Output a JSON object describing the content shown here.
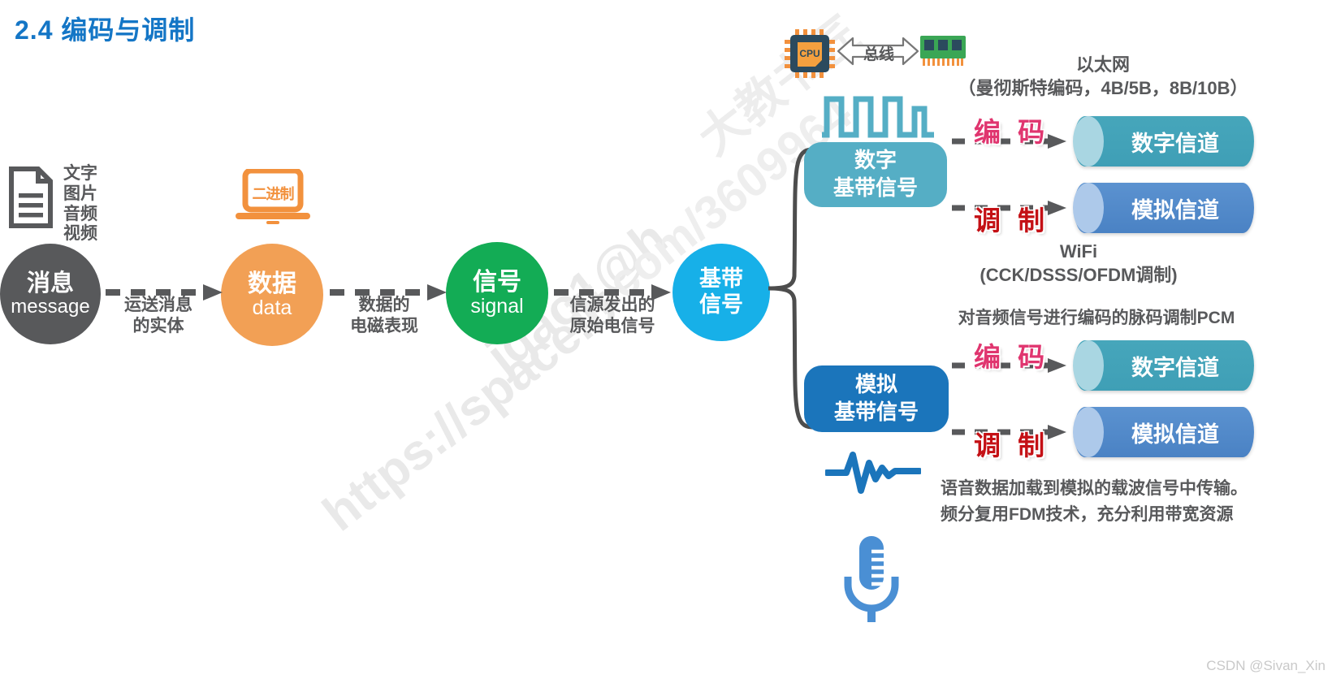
{
  "title": "2.4 编码与调制",
  "accent_color": "#1476c6",
  "flow": {
    "doc_label": "文字\n图片\n音频\n视频",
    "doc_lines": [
      "文字",
      "图片",
      "音频",
      "视频"
    ],
    "laptop_text": "二进制",
    "nodes": [
      {
        "cn": "消息",
        "en": "message",
        "color": "#58595b"
      },
      {
        "cn": "数据",
        "en": "data",
        "color": "#f2a055"
      },
      {
        "cn": "信号",
        "en": "signal",
        "color": "#13ac55"
      },
      {
        "cn": "基带",
        "en": "信号",
        "color": "#17b0e8"
      }
    ],
    "arrow_labels": [
      "运送消息\n的实体",
      "数据的\n电磁表现",
      "信源发出的\n原始电信号"
    ],
    "arrow_label_1a": "运送消息",
    "arrow_label_1b": "的实体",
    "arrow_label_2a": "数据的",
    "arrow_label_2b": "电磁表现",
    "arrow_label_3a": "信源发出的",
    "arrow_label_3b": "原始电信号"
  },
  "hardware": {
    "cpu_label": "CPU",
    "bus_label": "总线"
  },
  "right": {
    "digital_bb_line1": "数字",
    "digital_bb_line2": "基带信号",
    "analog_bb_line1": "模拟",
    "analog_bb_line2": "基带信号",
    "encode_label": "编 码",
    "modulate_label": "调 制",
    "ethernet_line1": "以太网",
    "ethernet_line2": "（曼彻斯特编码，4B/5B，8B/10B）",
    "wifi_line1": "WiFi",
    "wifi_line2": "(CCK/DSSS/OFDM调制)",
    "pcm_text": "对音频信号进行编码的脉码调制PCM",
    "fdm_line1": "语音数据加载到模拟的载波信号中传输。",
    "fdm_line2": "频分复用FDM技术，充分利用带宽资源",
    "channels": [
      {
        "label": "数字信道",
        "color": "#46a6bb"
      },
      {
        "label": "模拟信道",
        "color": "#5b92d0"
      },
      {
        "label": "数字信道",
        "color": "#46a6bb"
      },
      {
        "label": "模拟信道",
        "color": "#5b92d0"
      }
    ],
    "channel_digital": "数字信道",
    "channel_analog": "模拟信道"
  },
  "watermark": {
    "line1": "https://space.b",
    "line2": "jgao1@h",
    "line3": "ili.com/3609964",
    "line4": "大教书匠"
  },
  "footer": {
    "credit": "CSDN @Sivan_Xin"
  }
}
